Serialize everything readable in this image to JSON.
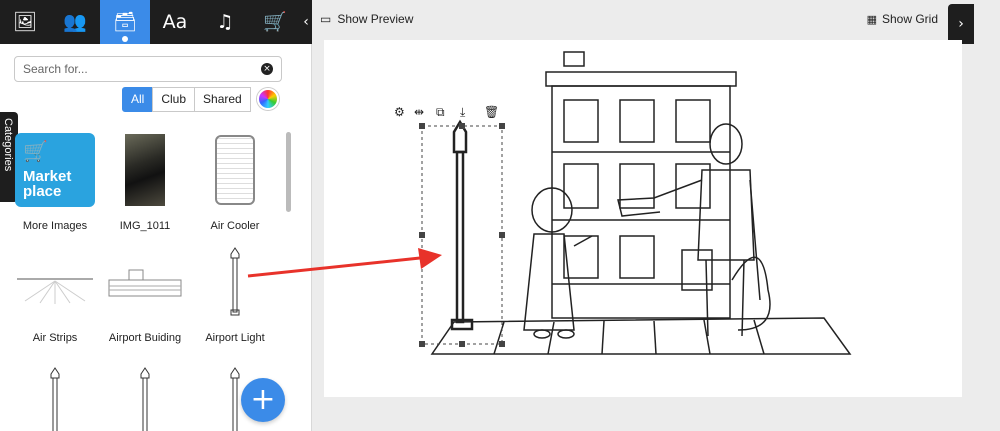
{
  "toolbar": {
    "tools": [
      {
        "name": "image-icon",
        "glyph": "🖼"
      },
      {
        "name": "characters-icon",
        "glyph": "👥"
      },
      {
        "name": "props-icon",
        "glyph": "🗃"
      },
      {
        "name": "text-icon",
        "glyph": "Aa"
      },
      {
        "name": "music-icon",
        "glyph": "♫"
      },
      {
        "name": "cart-icon",
        "glyph": "🛒"
      }
    ],
    "active_index": 2,
    "collapse_glyph": "‹"
  },
  "search": {
    "placeholder": "Search for...",
    "value": "",
    "clear_glyph": "×"
  },
  "filters": {
    "all": "All",
    "club": "Club",
    "shared": "Shared",
    "active": "All"
  },
  "categories_tab": "Categories",
  "marketplace": {
    "line1": "Market",
    "line2": "place"
  },
  "assets": [
    {
      "label": "More Images"
    },
    {
      "label": "IMG_1011"
    },
    {
      "label": "Air Cooler"
    },
    {
      "label": "Air Strips"
    },
    {
      "label": "Airport Buiding"
    },
    {
      "label": "Airport Light"
    }
  ],
  "fab": {
    "glyph": "+"
  },
  "topbar": {
    "show_preview": "Show Preview",
    "show_grid": "Show Grid",
    "preview_icon": "▭",
    "grid_icon": "▦",
    "collapse_glyph": "›"
  },
  "colors": {
    "accent": "#3b8be8",
    "dark": "#1e1e1e",
    "arrow": "#e8322a"
  }
}
